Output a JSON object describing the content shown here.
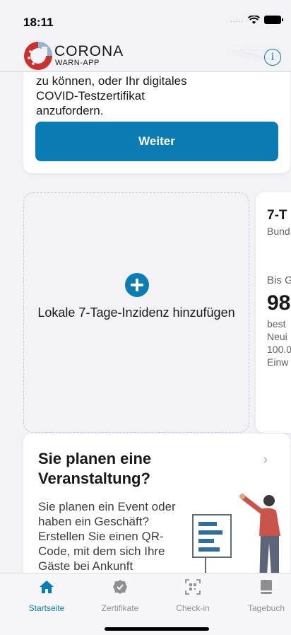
{
  "status_bar": {
    "time": "18:11",
    "dots": "....."
  },
  "header": {
    "brand_title": "CORONA",
    "brand_subtitle": "WARN-APP",
    "info_label": "i"
  },
  "test_card": {
    "text": "zu können, oder Ihr digitales COVID-Testzertifikat anzufordern.",
    "button_label": "Weiter"
  },
  "incidence_add": {
    "label": "Lokale 7-Tage-Inzidenz hinzufügen"
  },
  "incidence_card": {
    "title": "7-T",
    "subtitle": "Bund",
    "date": "Bis G",
    "value": "98",
    "description": "best\nNeui\n100.0\nEinw"
  },
  "event_card": {
    "title": "Sie planen eine Veranstaltung?",
    "text": "Sie planen ein Event oder haben ein Geschäft? Erstellen Sie einen QR-Code, mit dem sich Ihre Gäste bei Ankunft einchecken",
    "chevron": "›"
  },
  "tabs": [
    {
      "label": "Startseite",
      "icon": "home-icon",
      "active": true
    },
    {
      "label": "Zertifikate",
      "icon": "certificate-icon",
      "active": false
    },
    {
      "label": "Check-in",
      "icon": "qr-scan-icon",
      "active": false
    },
    {
      "label": "Tagebuch",
      "icon": "diary-icon",
      "active": false
    }
  ],
  "colors": {
    "accent": "#0b7cb4",
    "background": "#f2f2f7",
    "inactive": "#8e8e93",
    "logo_red": "#c7322c"
  }
}
